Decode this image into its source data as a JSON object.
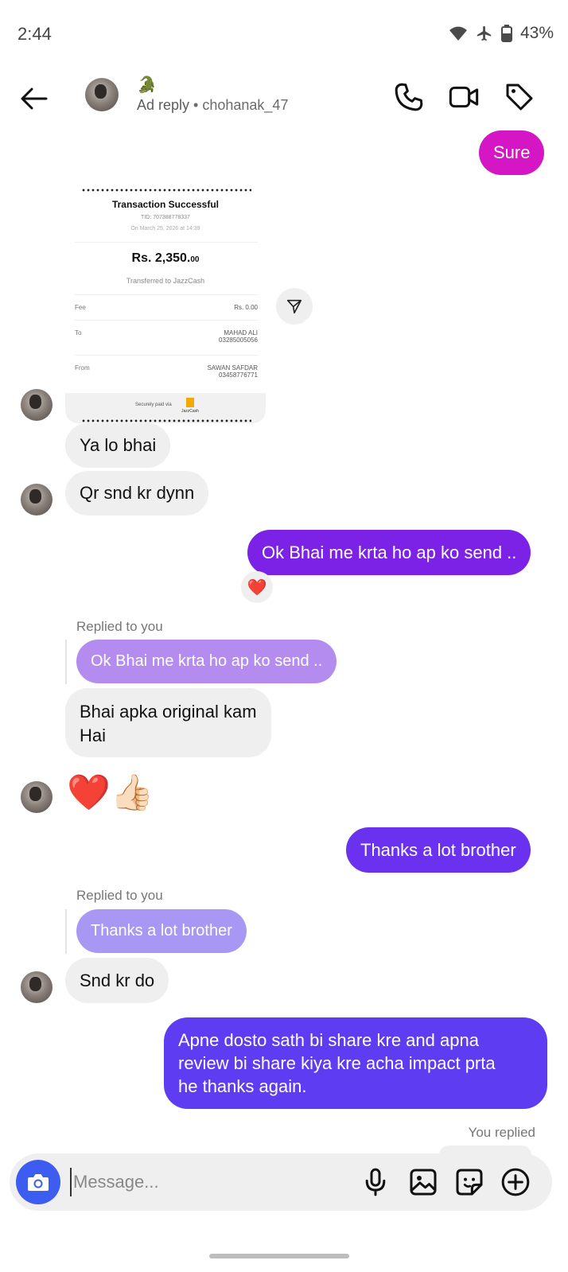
{
  "status_bar": {
    "time": "2:44",
    "battery": "43%"
  },
  "header": {
    "emoji": "🐊",
    "ad_label": "Ad reply",
    "separator": " • ",
    "username": "chohanak_47"
  },
  "messages": {
    "sure": "Sure",
    "receipt": {
      "title": "Transaction Successful",
      "tid": "TID: 707388778337",
      "date": "On March 25, 2026 at 14:39",
      "amount": "Rs. 2,350.",
      "amount_decimals": "00",
      "transferred_to": "Transferred to JazzCash",
      "fee_label": "Fee",
      "fee_value": "Rs. 0.00",
      "to_label": "To",
      "to_name": "MAHAD ALI",
      "to_number": "03285005056",
      "from_label": "From",
      "from_name": "SAWAN SAFDAR",
      "from_number": "03458776771",
      "footer": "Securely paid via",
      "brand": "JazzCash"
    },
    "ya_lo_bhai": "Ya lo bhai",
    "qr_snd": "Qr snd kr dynn",
    "ok_bhai": "Ok Bhai me krta ho ap ko send ..",
    "reaction_emoji": "❤️",
    "replied_to_you_1": "Replied to you",
    "quote_1": "Ok Bhai me krta ho ap ko send ..",
    "bhai_apka_line1": "Bhai apka original kam",
    "bhai_apka_line2": "Hai",
    "emojis": "❤️👍🏻",
    "thanks_brother": "Thanks a lot brother",
    "replied_to_you_2": "Replied to you",
    "quote_2": "Thanks a lot brother",
    "snd_kr_do": "Snd kr do",
    "apne_line1": "Apne dosto sath bi share kre and apna",
    "apne_line2": "review bi share kiya kre acha impact prta",
    "apne_line3": "he thanks again.",
    "you_replied": "You replied"
  },
  "composer": {
    "placeholder": "Message..."
  },
  "colors": {
    "magenta": "#d416c4",
    "purple_1": "#7b22e6",
    "purple_2": "#6a32ef",
    "purple_3": "#5d3cf1",
    "quote_1": "#b48cf0",
    "quote_2": "#a998f3",
    "incoming": "#efefef",
    "camera": "#3d5cf0"
  }
}
